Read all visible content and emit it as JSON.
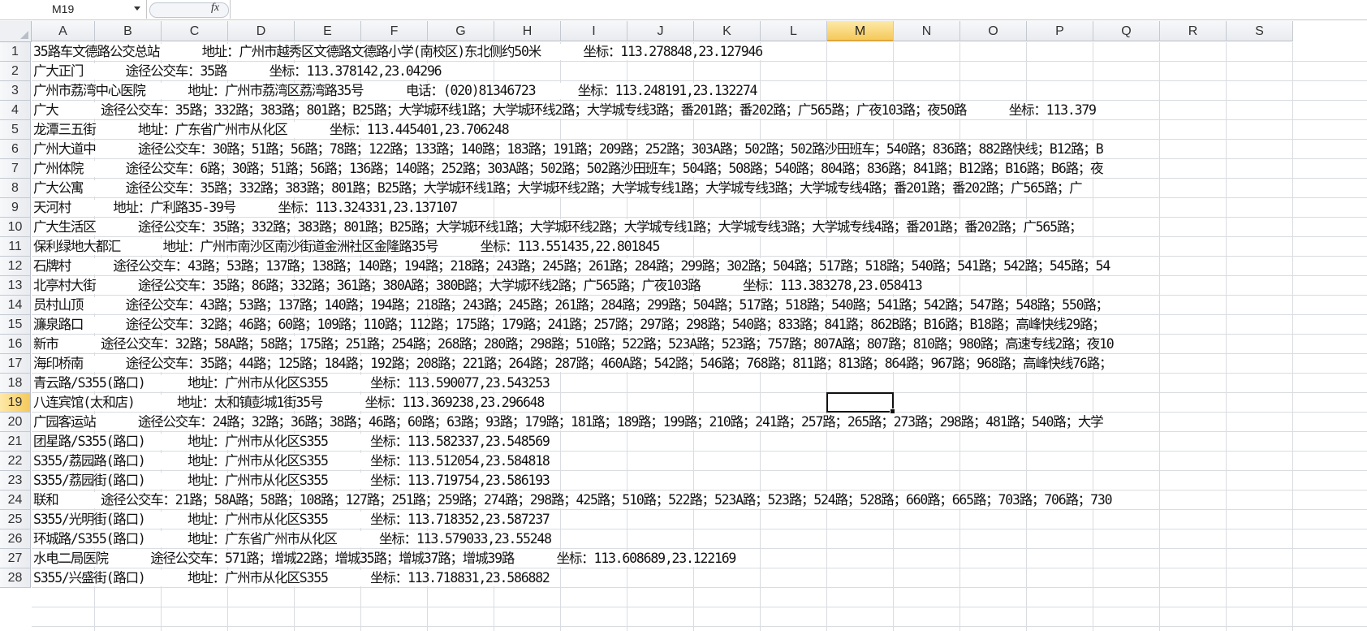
{
  "formula_bar": {
    "name_box": "M19",
    "fx_label": "fx",
    "formula": ""
  },
  "columns": [
    "A",
    "B",
    "C",
    "D",
    "E",
    "F",
    "G",
    "H",
    "I",
    "J",
    "K",
    "L",
    "M",
    "N",
    "O",
    "P",
    "Q",
    "R",
    "S"
  ],
  "selected_column": "M",
  "selected_row": "19",
  "rows": [
    {
      "num": "1",
      "text": "35路车文德路公交总站      地址：广州市越秀区文德路文德路小学(南校区)东北侧约50米      坐标：113.278848,23.127946"
    },
    {
      "num": "2",
      "text": "广大正门      途径公交车：35路      坐标：113.378142,23.04296"
    },
    {
      "num": "3",
      "text": "广州市荔湾中心医院      地址：广州市荔湾区荔湾路35号      电话：(020)81346723      坐标：113.248191,23.132274"
    },
    {
      "num": "4",
      "text": "广大      途径公交车：35路；332路；383路；801路；B25路；大学城环线1路；大学城环线2路；大学城专线3路；番201路；番202路；广565路；广夜103路；夜50路      坐标：113.379"
    },
    {
      "num": "5",
      "text": "龙潭三五街      地址：广东省广州市从化区      坐标：113.445401,23.706248"
    },
    {
      "num": "6",
      "text": "广州大道中      途径公交车：30路；51路；56路；78路；122路；133路；140路；183路；191路；209路；252路；303A路；502路；502路沙田班车；540路；836路；882路快线；B12路；B"
    },
    {
      "num": "7",
      "text": "广州体院      途径公交车：6路；30路；51路；56路；136路；140路；252路；303A路；502路；502路沙田班车；504路；508路；540路；804路；836路；841路；B12路；B16路；B6路；夜"
    },
    {
      "num": "8",
      "text": "广大公寓      途径公交车：35路；332路；383路；801路；B25路；大学城环线1路；大学城环线2路；大学城专线1路；大学城专线3路；大学城专线4路；番201路；番202路；广565路；广"
    },
    {
      "num": "9",
      "text": "天河村      地址：广利路35-39号      坐标：113.324331,23.137107"
    },
    {
      "num": "10",
      "text": "广大生活区      途径公交车：35路；332路；383路；801路；B25路；大学城环线1路；大学城环线2路；大学城专线1路；大学城专线3路；大学城专线4路；番201路；番202路；广565路；"
    },
    {
      "num": "11",
      "text": "保利绿地大都汇      地址：广州市南沙区南沙街道金洲社区金隆路35号      坐标：113.551435,22.801845"
    },
    {
      "num": "12",
      "text": "石牌村      途径公交车：43路；53路；137路；138路；140路；194路；218路；243路；245路；261路；284路；299路；302路；504路；517路；518路；540路；541路；542路；545路；54"
    },
    {
      "num": "13",
      "text": "北亭村大街      途径公交车：35路；86路；332路；361路；380A路；380B路；大学城环线2路；广565路；广夜103路      坐标：113.383278,23.058413"
    },
    {
      "num": "14",
      "text": "员村山顶      途径公交车：43路；53路；137路；140路；194路；218路；243路；245路；261路；284路；299路；504路；517路；518路；540路；541路；542路；547路；548路；550路；"
    },
    {
      "num": "15",
      "text": "濂泉路口      途径公交车：32路；46路；60路；109路；110路；112路；175路；179路；241路；257路；297路；298路；540路；833路；841路；862B路；B16路；B18路；高峰快线29路；"
    },
    {
      "num": "16",
      "text": "新市      途径公交车：32路；58A路；58路；175路；251路；254路；268路；280路；298路；510路；522路；523A路；523路；757路；807A路；807路；810路；980路；高速专线2路；夜10"
    },
    {
      "num": "17",
      "text": "海印桥南      途径公交车：35路；44路；125路；184路；192路；208路；221路；264路；287路；460A路；542路；546路；768路；811路；813路；864路；967路；968路；高峰快线76路；"
    },
    {
      "num": "18",
      "text": "青云路/S355(路口)      地址：广州市从化区S355      坐标：113.590077,23.543253"
    },
    {
      "num": "19",
      "text": "八连宾馆(太和店)      地址：太和镇彭城1街35号      坐标：113.369238,23.296648"
    },
    {
      "num": "20",
      "text": "广园客运站      途径公交车：24路；32路；36路；38路；46路；60路；63路；93路；179路；181路；189路；199路；210路；241路；257路；265路；273路；298路；481路；540路；大学"
    },
    {
      "num": "21",
      "text": "团星路/S355(路口)      地址：广州市从化区S355      坐标：113.582337,23.548569"
    },
    {
      "num": "22",
      "text": "S355/荔园路(路口)      地址：广州市从化区S355      坐标：113.512054,23.584818"
    },
    {
      "num": "23",
      "text": "S355/荔园街(路口)      地址：广州市从化区S355      坐标：113.719754,23.586193"
    },
    {
      "num": "24",
      "text": "联和      途径公交车：21路；58A路；58路；108路；127路；251路；259路；274路；298路；425路；510路；522路；523A路；523路；524路；528路；660路；665路；703路；706路；730"
    },
    {
      "num": "25",
      "text": "S355/光明街(路口)      地址：广州市从化区S355      坐标：113.718352,23.587237"
    },
    {
      "num": "26",
      "text": "环城路/S355(路口)      地址：广东省广州市从化区      坐标：113.579033,23.55248"
    },
    {
      "num": "27",
      "text": "水电二局医院      途径公交车：571路；增城22路；增城35路；增城37路；增城39路      坐标：113.608689,23.122169"
    },
    {
      "num": "28",
      "text": "S355/兴盛街(路口)      地址：广州市从化区S355      坐标：113.718831,23.586882"
    }
  ]
}
